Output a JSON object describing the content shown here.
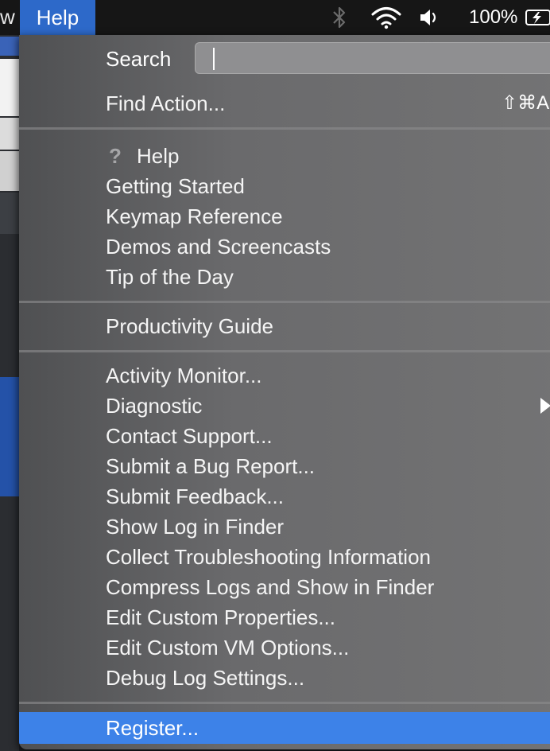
{
  "menubar": {
    "prev_menu_label": "w",
    "help_menu_label": "Help",
    "battery_percent": "100%",
    "icons": [
      "bluetooth-icon",
      "wifi-icon",
      "volume-icon",
      "battery-charging-icon"
    ]
  },
  "menu": {
    "search_label": "Search",
    "search_value": "",
    "find_action": {
      "label": "Find Action...",
      "shortcut": "⇧⌘A"
    },
    "group_help": [
      "Help",
      "Getting Started",
      "Keymap Reference",
      "Demos and Screencasts",
      "Tip of the Day"
    ],
    "productivity_guide": "Productivity Guide",
    "group_support": [
      "Activity Monitor...",
      "Diagnostic",
      "Contact Support...",
      "Submit a Bug Report...",
      "Submit Feedback...",
      "Show Log in Finder",
      "Collect Troubleshooting Information",
      "Compress Logs and Show in Finder",
      "Edit Custom Properties...",
      "Edit Custom VM Options...",
      "Debug Log Settings..."
    ],
    "register": "Register...",
    "highlighted_item": "Register...",
    "submenu_items": [
      "Diagnostic"
    ]
  },
  "colors": {
    "menu_highlight": "#3d82e8",
    "menubar_active": "#2d69c9",
    "menubar_bg": "#161616"
  }
}
